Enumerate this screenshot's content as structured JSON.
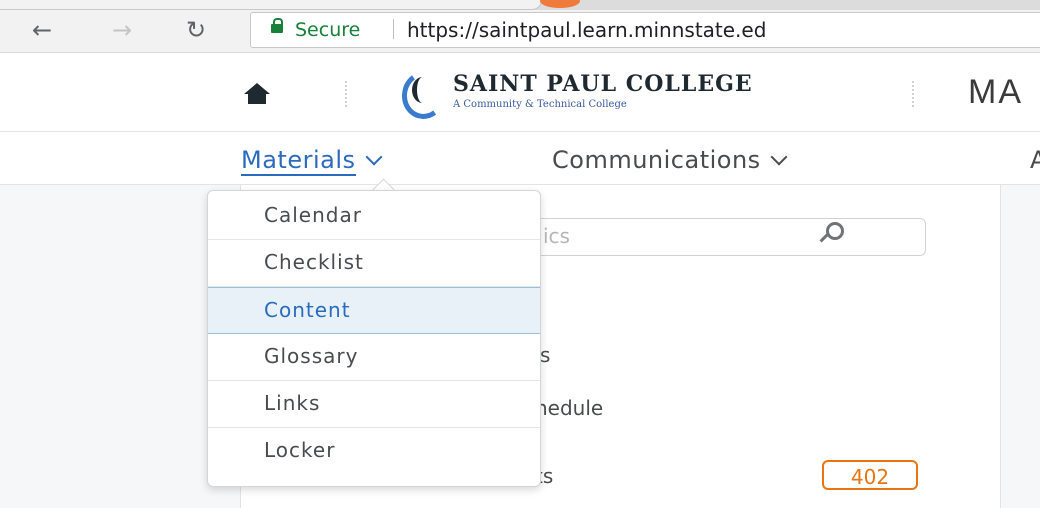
{
  "browser": {
    "secure_label": "Secure",
    "url": "https://saintpaul.learn.minnstate.ed"
  },
  "header": {
    "logo_title": "SAINT PAUL COLLEGE",
    "logo_subtitle": "A Community & Technical College",
    "course_title": "MA"
  },
  "navbar": {
    "items": [
      {
        "label": "Materials"
      },
      {
        "label": "Communications"
      },
      {
        "label": "A"
      }
    ]
  },
  "content": {
    "search_placeholder": "ics",
    "list_fragments": [
      "s",
      "nedule",
      "ts"
    ],
    "badge_count": "402"
  },
  "dropdown": {
    "items": [
      {
        "label": "Calendar"
      },
      {
        "label": "Checklist"
      },
      {
        "label": "Content",
        "active": true
      },
      {
        "label": "Glossary"
      },
      {
        "label": "Links"
      },
      {
        "label": "Locker"
      }
    ]
  },
  "colors": {
    "accent": "#2b6bbd",
    "secure_green": "#188038",
    "badge_orange": "#e87511"
  }
}
